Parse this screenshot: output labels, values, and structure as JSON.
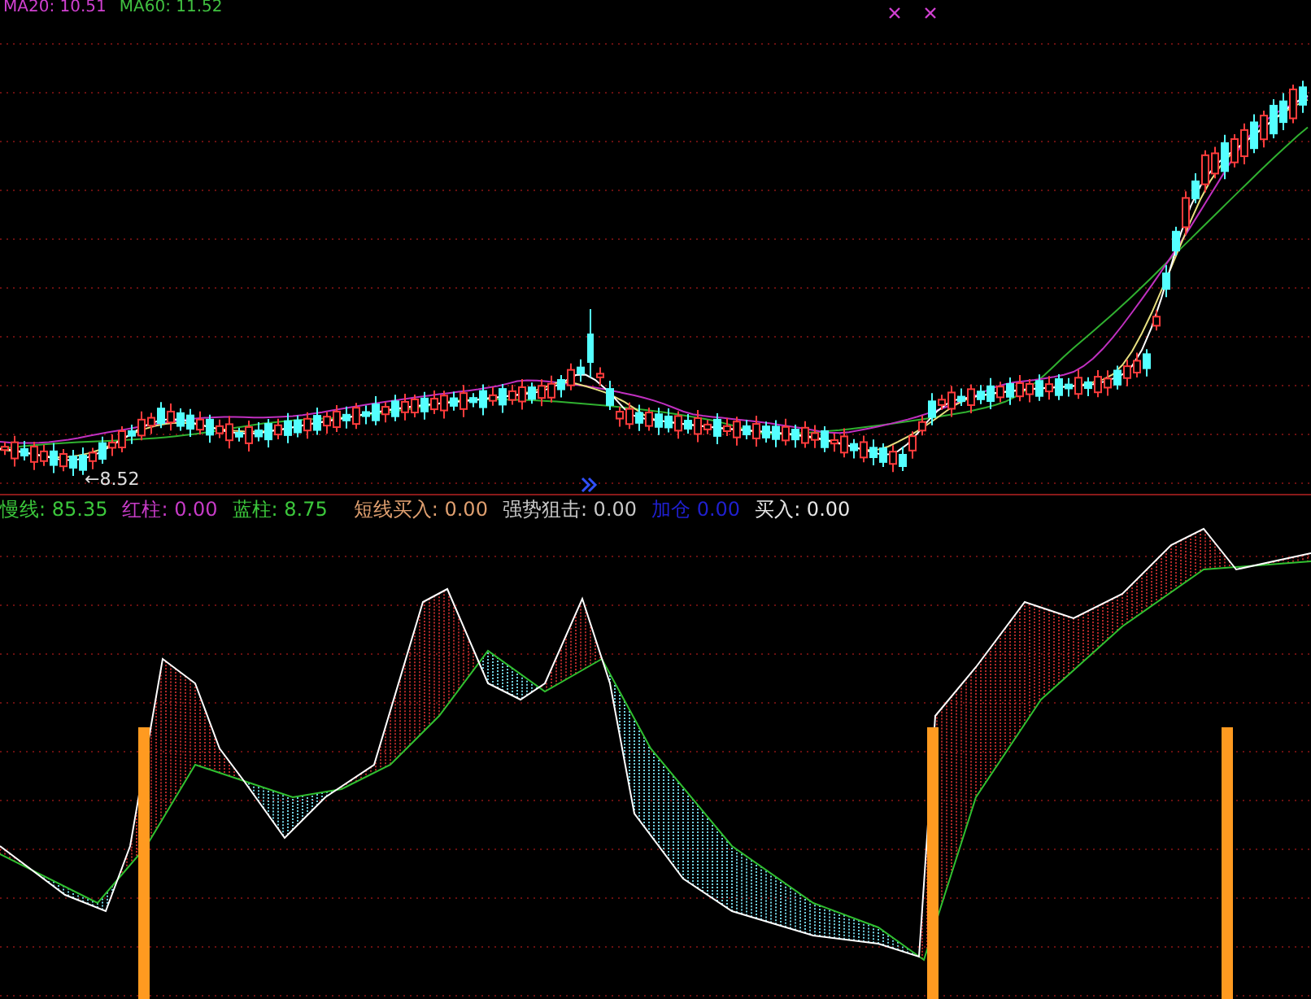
{
  "top_legend": [
    {
      "text": "MA20: 10.51",
      "color": "#d040d0"
    },
    {
      "text": "MA60: 11.52",
      "color": "#40c040"
    }
  ],
  "price_chart": {
    "low_label": "←8.52"
  },
  "indicator_legend": [
    {
      "text": "慢线: 85.35",
      "color": "#3cc83c"
    },
    {
      "text": "红柱: 0.00",
      "color": "#c83cc8"
    },
    {
      "text": "蓝柱: 8.75",
      "color": "#3cc83c"
    },
    {
      "text": "短线买入: 0.00",
      "color": "#e0a070"
    },
    {
      "text": "强势狙击: 0.00",
      "color": "#c8c8c8"
    },
    {
      "text": "加仓 0.00",
      "color": "#2020d0"
    },
    {
      "text": "买入: 0.00",
      "color": "#e8e8e8"
    }
  ]
}
